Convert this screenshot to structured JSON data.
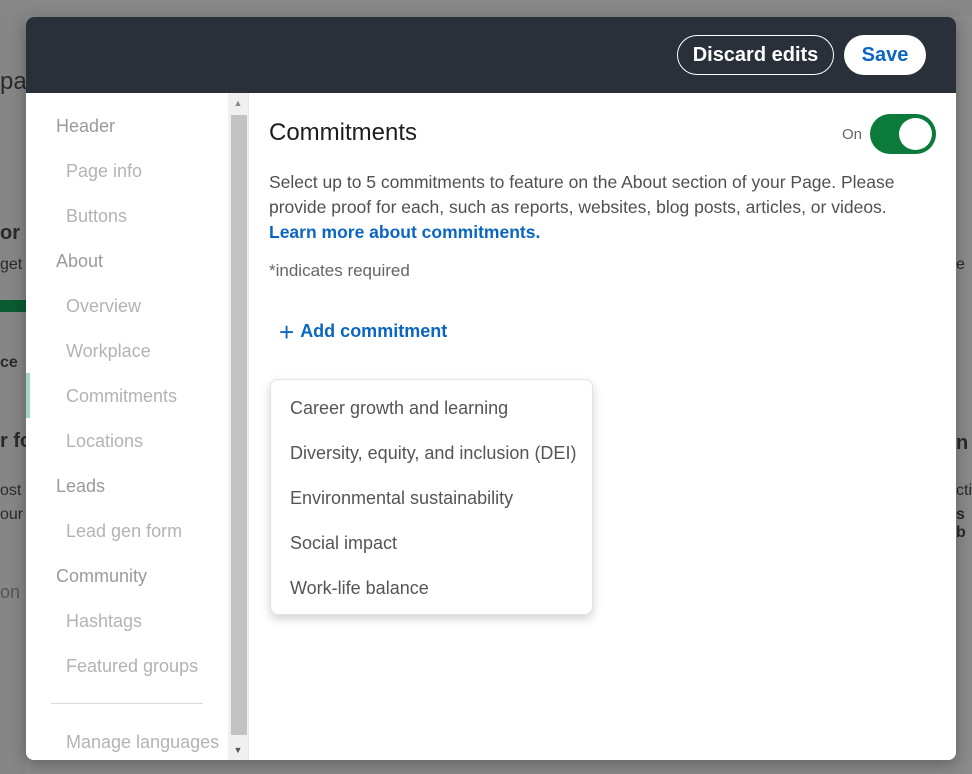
{
  "header": {
    "discard_label": "Discard edits",
    "save_label": "Save"
  },
  "sidebar": {
    "items": [
      {
        "label": "Header",
        "level": "section"
      },
      {
        "label": "Page info",
        "level": "sub"
      },
      {
        "label": "Buttons",
        "level": "sub"
      },
      {
        "label": "About",
        "level": "section"
      },
      {
        "label": "Overview",
        "level": "sub"
      },
      {
        "label": "Workplace",
        "level": "sub"
      },
      {
        "label": "Commitments",
        "level": "sub",
        "active": true
      },
      {
        "label": "Locations",
        "level": "sub"
      },
      {
        "label": "Leads",
        "level": "section"
      },
      {
        "label": "Lead gen form",
        "level": "sub"
      },
      {
        "label": "Community",
        "level": "section"
      },
      {
        "label": "Hashtags",
        "level": "sub"
      },
      {
        "label": "Featured groups",
        "level": "sub"
      },
      {
        "label": "Manage languages",
        "level": "sub"
      }
    ]
  },
  "main": {
    "title": "Commitments",
    "toggle_label": "On",
    "toggle_on": true,
    "description": "Select up to 5 commitments to feature on the About section of your Page. Please provide proof for each, such as reports, websites, blog posts, articles, or videos.",
    "learn_more": "Learn more about commitments.",
    "required_star": "*",
    "required_text": "indicates required",
    "add_commitment_label": "Add commitment",
    "add_icon": "plus-icon",
    "dropdown_options": [
      "Career growth and learning",
      "Diversity, equity, and inclusion (DEI)",
      "Environmental sustainability",
      "Social impact",
      "Work-life balance"
    ]
  },
  "background": {
    "fragments": [
      "pa",
      "or s",
      "get",
      "ce",
      "r fo",
      "ost",
      "our",
      "on",
      "e",
      "n",
      "ctic",
      "s b"
    ]
  },
  "colors": {
    "header_bg": "#293039",
    "accent_blue": "#0a66c2",
    "toggle_green": "#0b7a3b",
    "active_indicator": "#9ed9c0"
  }
}
